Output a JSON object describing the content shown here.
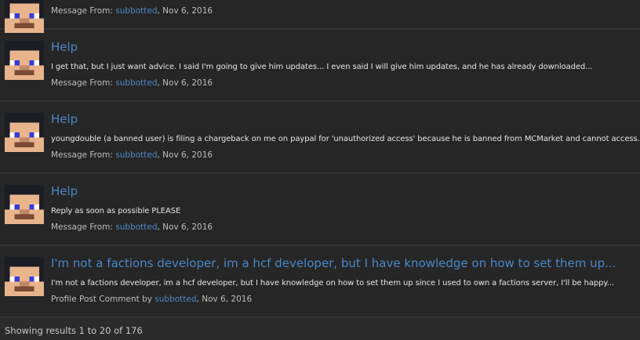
{
  "results": [
    {
      "title": "",
      "snippet": "",
      "meta_prefix": "Message From: ",
      "user": "subbotted",
      "date": ", Nov 6, 2016"
    },
    {
      "title": "Help",
      "snippet": "I get that, but I just want advice. I said I'm going to give him updates... I even said I will give him updates, and he has already downloaded...",
      "meta_prefix": "Message From: ",
      "user": "subbotted",
      "date": ", Nov 6, 2016"
    },
    {
      "title": "Help",
      "snippet": "youngdouble (a banned user) is filing a chargeback on me on paypal for 'unauthorized access' because he is banned from MCMarket and cannot access...",
      "meta_prefix": "Message From: ",
      "user": "subbotted",
      "date": ", Nov 6, 2016"
    },
    {
      "title": "Help",
      "snippet": "Reply as soon as possible PLEASE",
      "meta_prefix": "Message From: ",
      "user": "subbotted",
      "date": ", Nov 6, 2016"
    },
    {
      "title": "I'm not a factions developer, im a hcf developer, but I have knowledge on how to set them up...",
      "snippet": "I'm not a factions developer, im a hcf developer, but I have knowledge on how to set them up since I used to own a factions server, I'll be happy...",
      "meta_prefix": "Profile Post Comment by ",
      "user": "subbotted",
      "date": ", Nov 6, 2016"
    }
  ],
  "footer": {
    "results_text": "Showing results 1 to 20 of 176"
  },
  "colors": {
    "background": "#262626",
    "link": "#4a88c8",
    "divider": "#333333"
  },
  "icons": {
    "avatar": "minecraft-skin-avatar-icon"
  }
}
